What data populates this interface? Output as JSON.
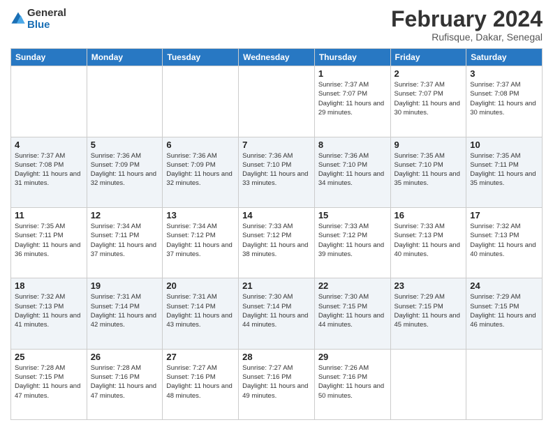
{
  "header": {
    "logo_general": "General",
    "logo_blue": "Blue",
    "month_title": "February 2024",
    "subtitle": "Rufisque, Dakar, Senegal"
  },
  "days_of_week": [
    "Sunday",
    "Monday",
    "Tuesday",
    "Wednesday",
    "Thursday",
    "Friday",
    "Saturday"
  ],
  "weeks": [
    [
      {
        "day": "",
        "info": ""
      },
      {
        "day": "",
        "info": ""
      },
      {
        "day": "",
        "info": ""
      },
      {
        "day": "",
        "info": ""
      },
      {
        "day": "1",
        "info": "Sunrise: 7:37 AM\nSunset: 7:07 PM\nDaylight: 11 hours and 29 minutes."
      },
      {
        "day": "2",
        "info": "Sunrise: 7:37 AM\nSunset: 7:07 PM\nDaylight: 11 hours and 30 minutes."
      },
      {
        "day": "3",
        "info": "Sunrise: 7:37 AM\nSunset: 7:08 PM\nDaylight: 11 hours and 30 minutes."
      }
    ],
    [
      {
        "day": "4",
        "info": "Sunrise: 7:37 AM\nSunset: 7:08 PM\nDaylight: 11 hours and 31 minutes."
      },
      {
        "day": "5",
        "info": "Sunrise: 7:36 AM\nSunset: 7:09 PM\nDaylight: 11 hours and 32 minutes."
      },
      {
        "day": "6",
        "info": "Sunrise: 7:36 AM\nSunset: 7:09 PM\nDaylight: 11 hours and 32 minutes."
      },
      {
        "day": "7",
        "info": "Sunrise: 7:36 AM\nSunset: 7:10 PM\nDaylight: 11 hours and 33 minutes."
      },
      {
        "day": "8",
        "info": "Sunrise: 7:36 AM\nSunset: 7:10 PM\nDaylight: 11 hours and 34 minutes."
      },
      {
        "day": "9",
        "info": "Sunrise: 7:35 AM\nSunset: 7:10 PM\nDaylight: 11 hours and 35 minutes."
      },
      {
        "day": "10",
        "info": "Sunrise: 7:35 AM\nSunset: 7:11 PM\nDaylight: 11 hours and 35 minutes."
      }
    ],
    [
      {
        "day": "11",
        "info": "Sunrise: 7:35 AM\nSunset: 7:11 PM\nDaylight: 11 hours and 36 minutes."
      },
      {
        "day": "12",
        "info": "Sunrise: 7:34 AM\nSunset: 7:11 PM\nDaylight: 11 hours and 37 minutes."
      },
      {
        "day": "13",
        "info": "Sunrise: 7:34 AM\nSunset: 7:12 PM\nDaylight: 11 hours and 37 minutes."
      },
      {
        "day": "14",
        "info": "Sunrise: 7:33 AM\nSunset: 7:12 PM\nDaylight: 11 hours and 38 minutes."
      },
      {
        "day": "15",
        "info": "Sunrise: 7:33 AM\nSunset: 7:12 PM\nDaylight: 11 hours and 39 minutes."
      },
      {
        "day": "16",
        "info": "Sunrise: 7:33 AM\nSunset: 7:13 PM\nDaylight: 11 hours and 40 minutes."
      },
      {
        "day": "17",
        "info": "Sunrise: 7:32 AM\nSunset: 7:13 PM\nDaylight: 11 hours and 40 minutes."
      }
    ],
    [
      {
        "day": "18",
        "info": "Sunrise: 7:32 AM\nSunset: 7:13 PM\nDaylight: 11 hours and 41 minutes."
      },
      {
        "day": "19",
        "info": "Sunrise: 7:31 AM\nSunset: 7:14 PM\nDaylight: 11 hours and 42 minutes."
      },
      {
        "day": "20",
        "info": "Sunrise: 7:31 AM\nSunset: 7:14 PM\nDaylight: 11 hours and 43 minutes."
      },
      {
        "day": "21",
        "info": "Sunrise: 7:30 AM\nSunset: 7:14 PM\nDaylight: 11 hours and 44 minutes."
      },
      {
        "day": "22",
        "info": "Sunrise: 7:30 AM\nSunset: 7:15 PM\nDaylight: 11 hours and 44 minutes."
      },
      {
        "day": "23",
        "info": "Sunrise: 7:29 AM\nSunset: 7:15 PM\nDaylight: 11 hours and 45 minutes."
      },
      {
        "day": "24",
        "info": "Sunrise: 7:29 AM\nSunset: 7:15 PM\nDaylight: 11 hours and 46 minutes."
      }
    ],
    [
      {
        "day": "25",
        "info": "Sunrise: 7:28 AM\nSunset: 7:15 PM\nDaylight: 11 hours and 47 minutes."
      },
      {
        "day": "26",
        "info": "Sunrise: 7:28 AM\nSunset: 7:16 PM\nDaylight: 11 hours and 47 minutes."
      },
      {
        "day": "27",
        "info": "Sunrise: 7:27 AM\nSunset: 7:16 PM\nDaylight: 11 hours and 48 minutes."
      },
      {
        "day": "28",
        "info": "Sunrise: 7:27 AM\nSunset: 7:16 PM\nDaylight: 11 hours and 49 minutes."
      },
      {
        "day": "29",
        "info": "Sunrise: 7:26 AM\nSunset: 7:16 PM\nDaylight: 11 hours and 50 minutes."
      },
      {
        "day": "",
        "info": ""
      },
      {
        "day": "",
        "info": ""
      }
    ]
  ]
}
